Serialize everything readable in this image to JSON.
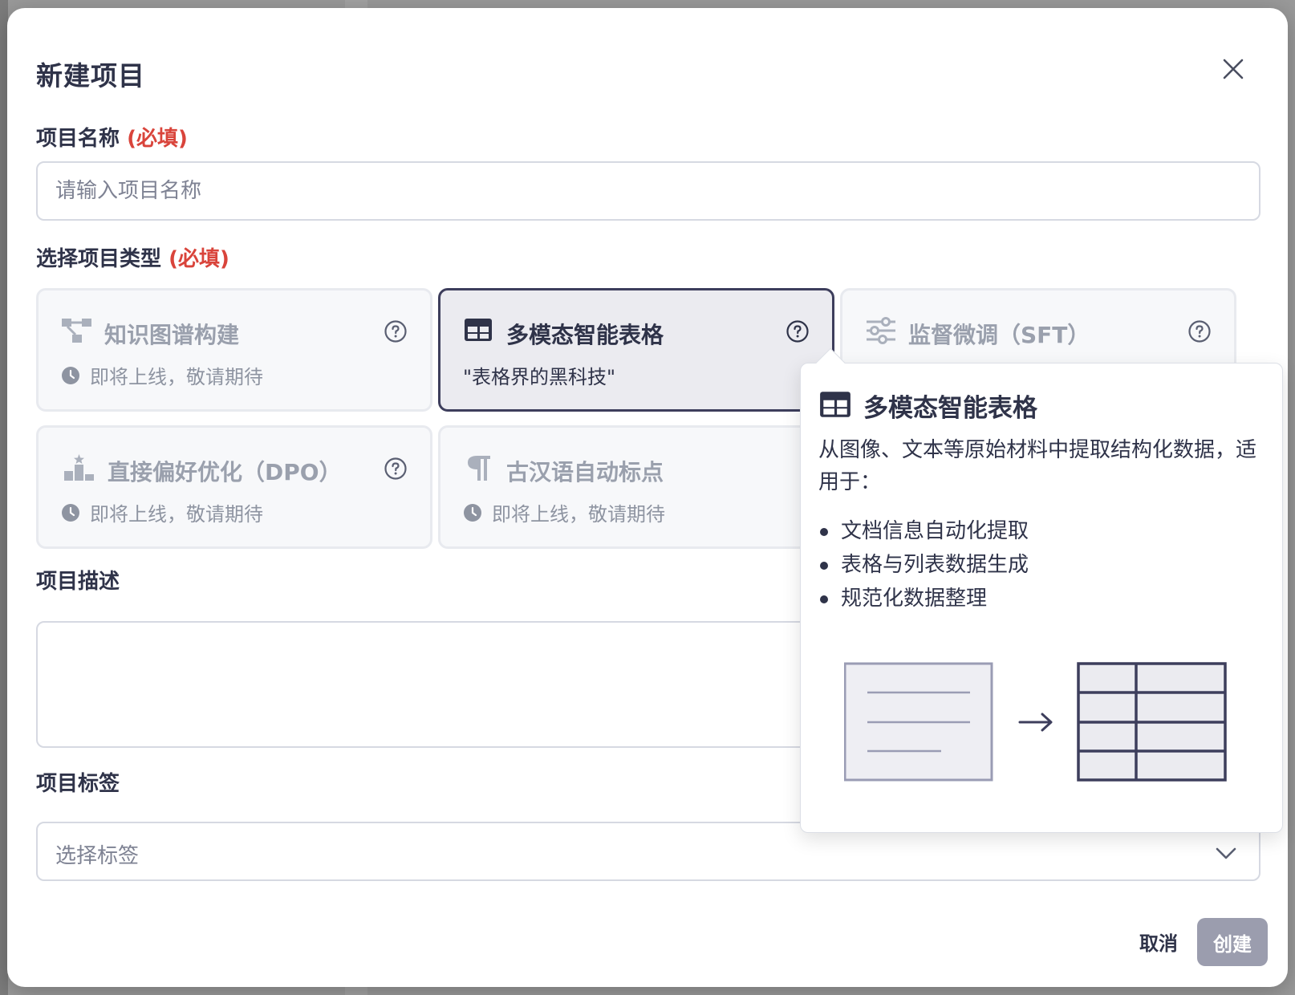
{
  "modal": {
    "title": "新建项目",
    "name_label": "项目名称",
    "required_tag": "(必填)",
    "name_placeholder": "请输入项目名称",
    "type_label": "选择项目类型",
    "desc_label": "项目描述",
    "tags_label": "项目标签",
    "tags_placeholder": "选择标签",
    "cancel_label": "取消",
    "create_label": "创建"
  },
  "types": [
    {
      "title": "知识图谱构建",
      "subtitle": "即将上线，敬请期待",
      "icon": "graph-icon",
      "selected": false
    },
    {
      "title": "多模态智能表格",
      "subtitle": "\"表格界的黑科技\"",
      "icon": "table-icon",
      "selected": true
    },
    {
      "title": "监督微调（SFT）",
      "subtitle": "",
      "icon": "sliders-icon",
      "selected": false
    },
    {
      "title": "直接偏好优化（DPO）",
      "subtitle": "即将上线，敬请期待",
      "icon": "podium-icon",
      "selected": false
    },
    {
      "title": "古汉语自动标点",
      "subtitle": "即将上线，敬请期待",
      "icon": "pilcrow-icon",
      "selected": false
    }
  ],
  "tooltip": {
    "title": "多模态智能表格",
    "description": "从图像、文本等原始材料中提取结构化数据，适用于：",
    "items": [
      "文档信息自动化提取",
      "表格与列表数据生成",
      "规范化数据整理"
    ]
  },
  "colors": {
    "text": "#2f3349",
    "required": "#d9443b",
    "muted": "#9aa0ad",
    "selected_border": "#3d3e5c",
    "create_button": "#9b9dae"
  }
}
